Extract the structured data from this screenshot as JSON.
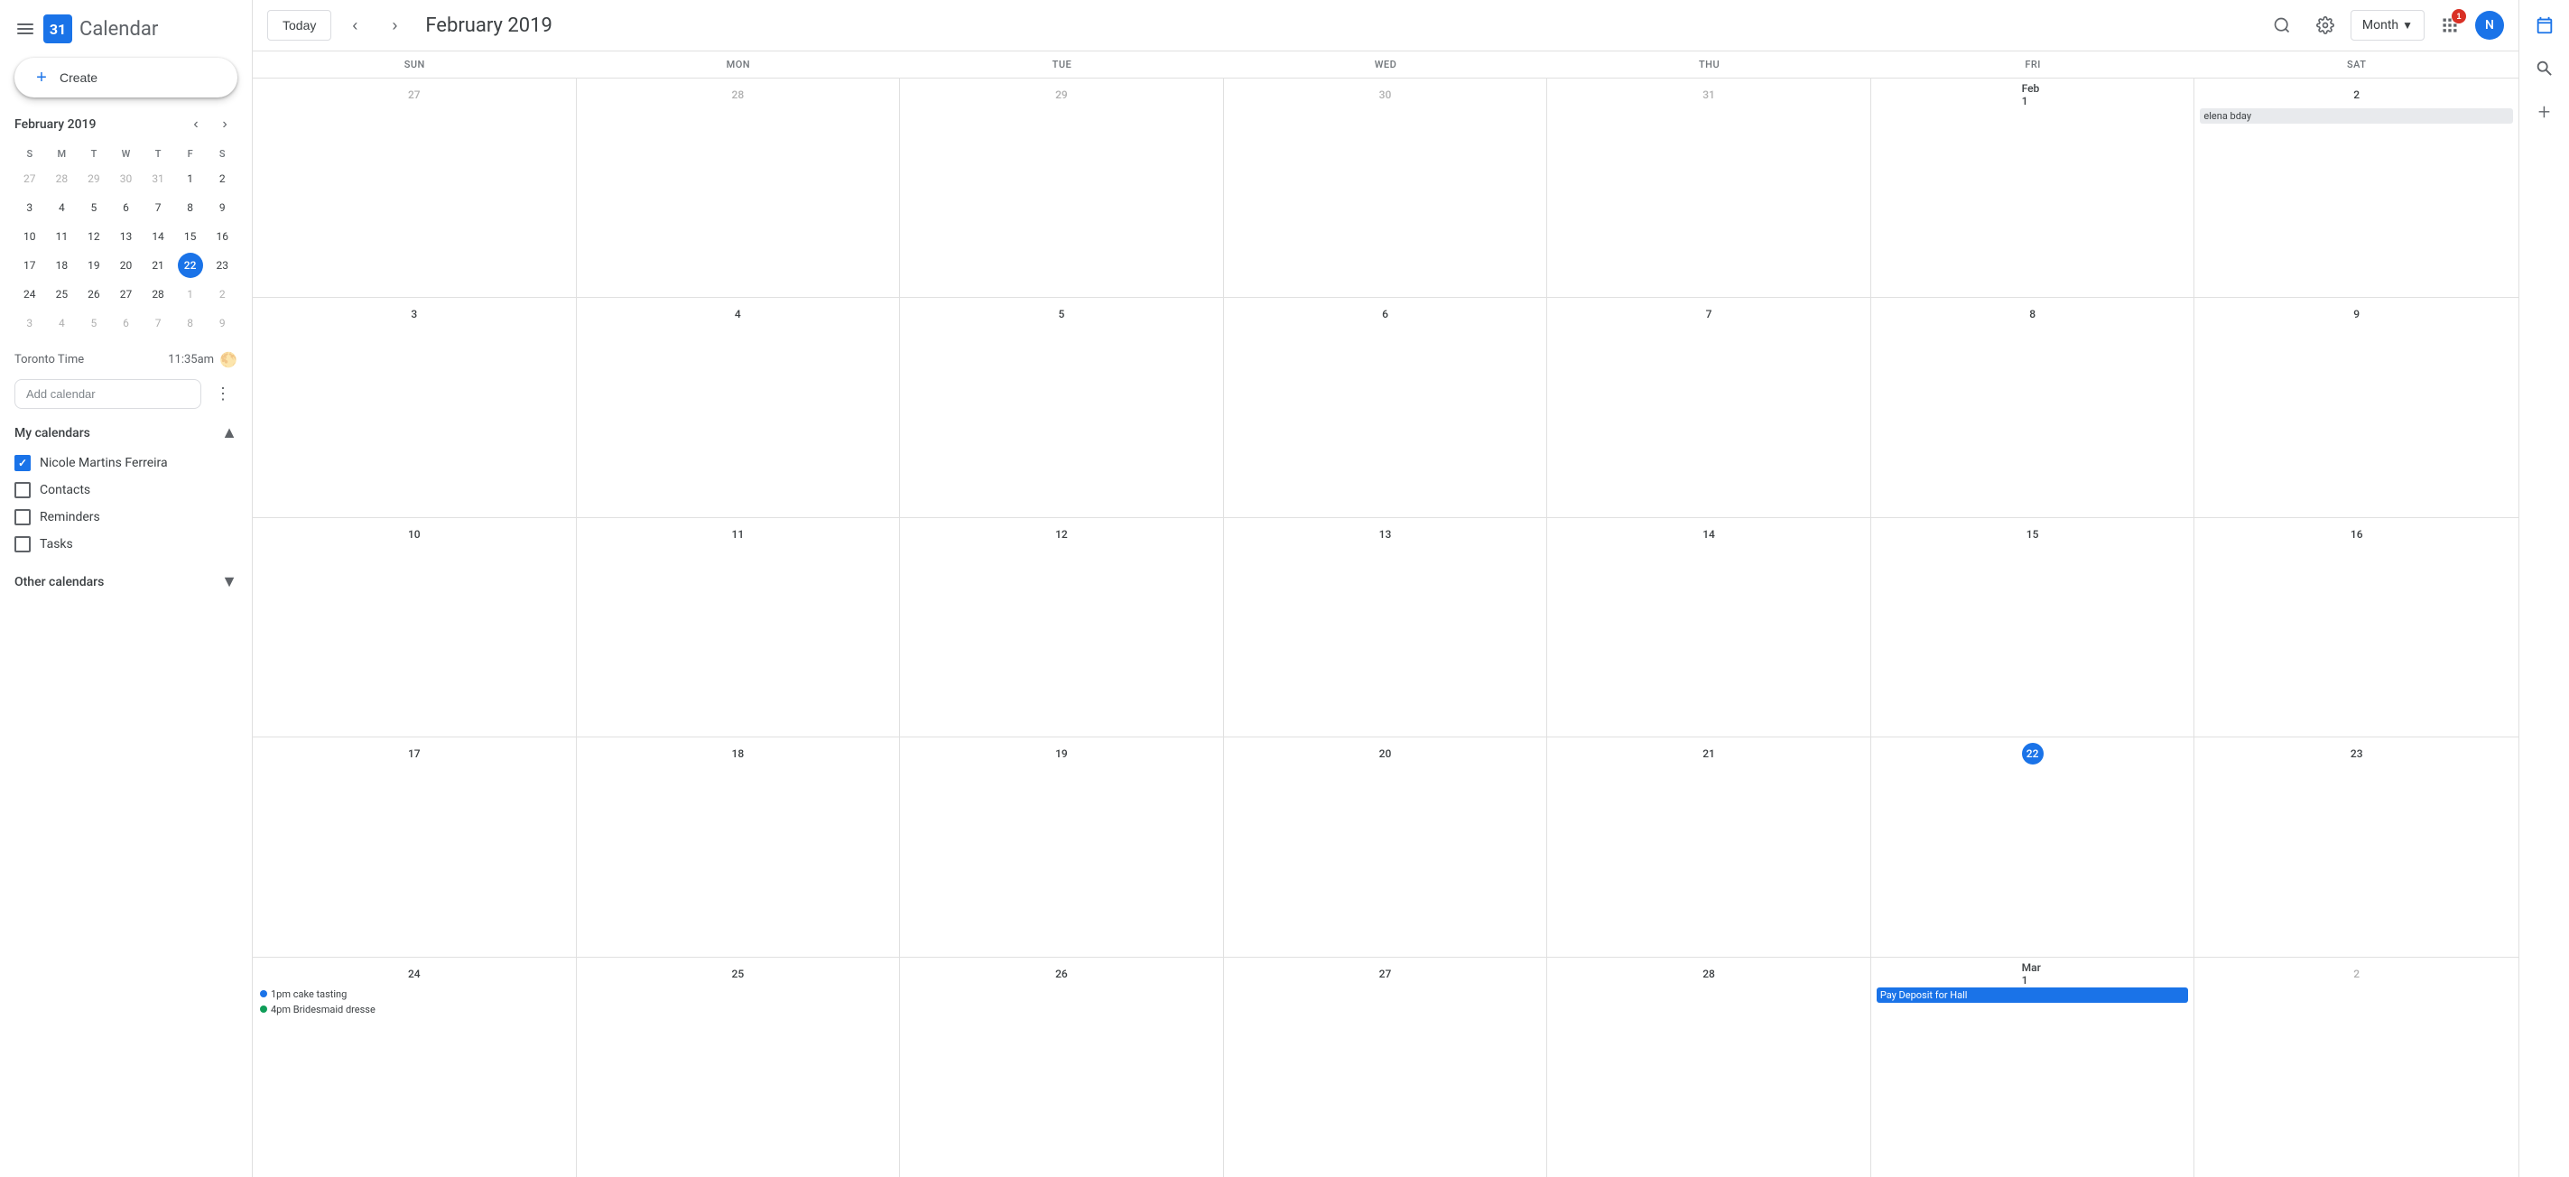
{
  "app": {
    "logo_number": "31",
    "title": "Calendar"
  },
  "topbar": {
    "today_label": "Today",
    "month_title": "February 2019",
    "view_selector": "Month",
    "avatar_initials": "N"
  },
  "mini_calendar": {
    "title": "February 2019",
    "day_headers": [
      "S",
      "M",
      "T",
      "W",
      "T",
      "F",
      "S"
    ],
    "weeks": [
      [
        {
          "day": 27,
          "other": true
        },
        {
          "day": 28,
          "other": true
        },
        {
          "day": 29,
          "other": true
        },
        {
          "day": 30,
          "other": true
        },
        {
          "day": 31,
          "other": true
        },
        {
          "day": 1,
          "other": false
        },
        {
          "day": 2,
          "other": false
        }
      ],
      [
        {
          "day": 3,
          "other": false
        },
        {
          "day": 4,
          "other": false
        },
        {
          "day": 5,
          "other": false
        },
        {
          "day": 6,
          "other": false
        },
        {
          "day": 7,
          "other": false
        },
        {
          "day": 8,
          "other": false
        },
        {
          "day": 9,
          "other": false
        }
      ],
      [
        {
          "day": 10,
          "other": false
        },
        {
          "day": 11,
          "other": false
        },
        {
          "day": 12,
          "other": false
        },
        {
          "day": 13,
          "other": false
        },
        {
          "day": 14,
          "other": false
        },
        {
          "day": 15,
          "other": false
        },
        {
          "day": 16,
          "other": false
        }
      ],
      [
        {
          "day": 17,
          "other": false
        },
        {
          "day": 18,
          "other": false
        },
        {
          "day": 19,
          "other": false
        },
        {
          "day": 20,
          "other": false
        },
        {
          "day": 21,
          "other": false
        },
        {
          "day": 22,
          "other": false,
          "today": true
        },
        {
          "day": 23,
          "other": false
        }
      ],
      [
        {
          "day": 24,
          "other": false
        },
        {
          "day": 25,
          "other": false
        },
        {
          "day": 26,
          "other": false
        },
        {
          "day": 27,
          "other": false
        },
        {
          "day": 28,
          "other": false
        },
        {
          "day": 1,
          "other": true
        },
        {
          "day": 2,
          "other": true
        }
      ],
      [
        {
          "day": 3,
          "other": true
        },
        {
          "day": 4,
          "other": true
        },
        {
          "day": 5,
          "other": true
        },
        {
          "day": 6,
          "other": true
        },
        {
          "day": 7,
          "other": true
        },
        {
          "day": 8,
          "other": true
        },
        {
          "day": 9,
          "other": true
        }
      ]
    ]
  },
  "timezone": {
    "label": "Toronto Time",
    "time": "11:35am"
  },
  "add_calendar": {
    "placeholder": "Add calendar"
  },
  "my_calendars": {
    "section_title": "My calendars",
    "items": [
      {
        "label": "Nicole Martins Ferreira",
        "checked": true
      },
      {
        "label": "Contacts",
        "checked": false
      },
      {
        "label": "Reminders",
        "checked": false
      },
      {
        "label": "Tasks",
        "checked": false
      }
    ]
  },
  "other_calendars": {
    "section_title": "Other calendars"
  },
  "calendar_header": [
    "SUN",
    "MON",
    "TUE",
    "WED",
    "THU",
    "FRI",
    "SAT"
  ],
  "calendar_weeks": [
    {
      "cells": [
        {
          "date": "27",
          "other": true,
          "events": []
        },
        {
          "date": "28",
          "other": true,
          "events": []
        },
        {
          "date": "29",
          "other": true,
          "events": []
        },
        {
          "date": "30",
          "other": true,
          "events": []
        },
        {
          "date": "31",
          "other": true,
          "events": []
        },
        {
          "date": "Feb 1",
          "other": false,
          "events": []
        },
        {
          "date": "2",
          "other": false,
          "events": [
            {
              "type": "gray",
              "label": "elena bday"
            }
          ]
        }
      ]
    },
    {
      "cells": [
        {
          "date": "3",
          "other": false,
          "events": []
        },
        {
          "date": "4",
          "other": false,
          "events": []
        },
        {
          "date": "5",
          "other": false,
          "events": []
        },
        {
          "date": "6",
          "other": false,
          "events": []
        },
        {
          "date": "7",
          "other": false,
          "events": []
        },
        {
          "date": "8",
          "other": false,
          "events": []
        },
        {
          "date": "9",
          "other": false,
          "events": []
        }
      ]
    },
    {
      "cells": [
        {
          "date": "10",
          "other": false,
          "events": []
        },
        {
          "date": "11",
          "other": false,
          "events": []
        },
        {
          "date": "12",
          "other": false,
          "events": []
        },
        {
          "date": "13",
          "other": false,
          "events": []
        },
        {
          "date": "14",
          "other": false,
          "events": []
        },
        {
          "date": "15",
          "other": false,
          "events": []
        },
        {
          "date": "16",
          "other": false,
          "events": []
        }
      ]
    },
    {
      "cells": [
        {
          "date": "17",
          "other": false,
          "events": []
        },
        {
          "date": "18",
          "other": false,
          "events": []
        },
        {
          "date": "19",
          "other": false,
          "events": []
        },
        {
          "date": "20",
          "other": false,
          "events": []
        },
        {
          "date": "21",
          "other": false,
          "events": []
        },
        {
          "date": "22",
          "other": false,
          "today": true,
          "events": []
        },
        {
          "date": "23",
          "other": false,
          "events": []
        }
      ]
    },
    {
      "cells": [
        {
          "date": "24",
          "other": false,
          "events": [
            {
              "type": "dot-blue",
              "label": "1pm cake tasting"
            },
            {
              "type": "dot-green",
              "label": "4pm Bridesmaid dresse"
            }
          ]
        },
        {
          "date": "25",
          "other": false,
          "events": []
        },
        {
          "date": "26",
          "other": false,
          "events": []
        },
        {
          "date": "27",
          "other": false,
          "events": []
        },
        {
          "date": "28",
          "other": false,
          "events": []
        },
        {
          "date": "Mar 1",
          "other": false,
          "events": [
            {
              "type": "blue",
              "label": "Pay Deposit for Hall"
            }
          ]
        },
        {
          "date": "2",
          "other": true,
          "events": []
        }
      ]
    }
  ]
}
